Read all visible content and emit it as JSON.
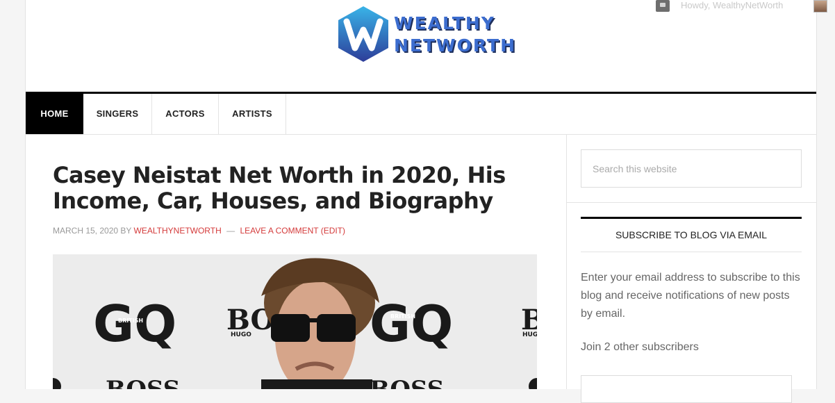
{
  "adminbar": {
    "howdy": "Howdy, WealthyNetWorth"
  },
  "logo": {
    "line1": "WEALTHY",
    "line2": "NETWORTH"
  },
  "nav": [
    {
      "label": "HOME",
      "active": true
    },
    {
      "label": "SINGERS"
    },
    {
      "label": "ACTORS"
    },
    {
      "label": "ARTISTS"
    }
  ],
  "post": {
    "title": "Casey Neistat Net Worth in 2020, His Income, Car, Houses, and Biography",
    "date": "MARCH 15, 2020",
    "by": "BY",
    "author": "WEALTHYNETWORTH",
    "separator": "—",
    "comment_link": "LEAVE A COMMENT",
    "edit_link": "(EDIT)",
    "image_text": {
      "gq": "GQ",
      "british": "BRITISH",
      "boss": "BOSS",
      "hugo": "HUGO"
    }
  },
  "sidebar": {
    "search_placeholder": "Search this website",
    "subscribe_title": "SUBSCRIBE TO BLOG VIA EMAIL",
    "subscribe_text": "Enter your email address to subscribe to this blog and receive notifications of new posts by email.",
    "subscribers": "Join 2 other subscribers"
  },
  "colors": {
    "accent_red": "#d43a3a",
    "nav_active": "#000000",
    "logo_blue": "#2b4fa0"
  }
}
